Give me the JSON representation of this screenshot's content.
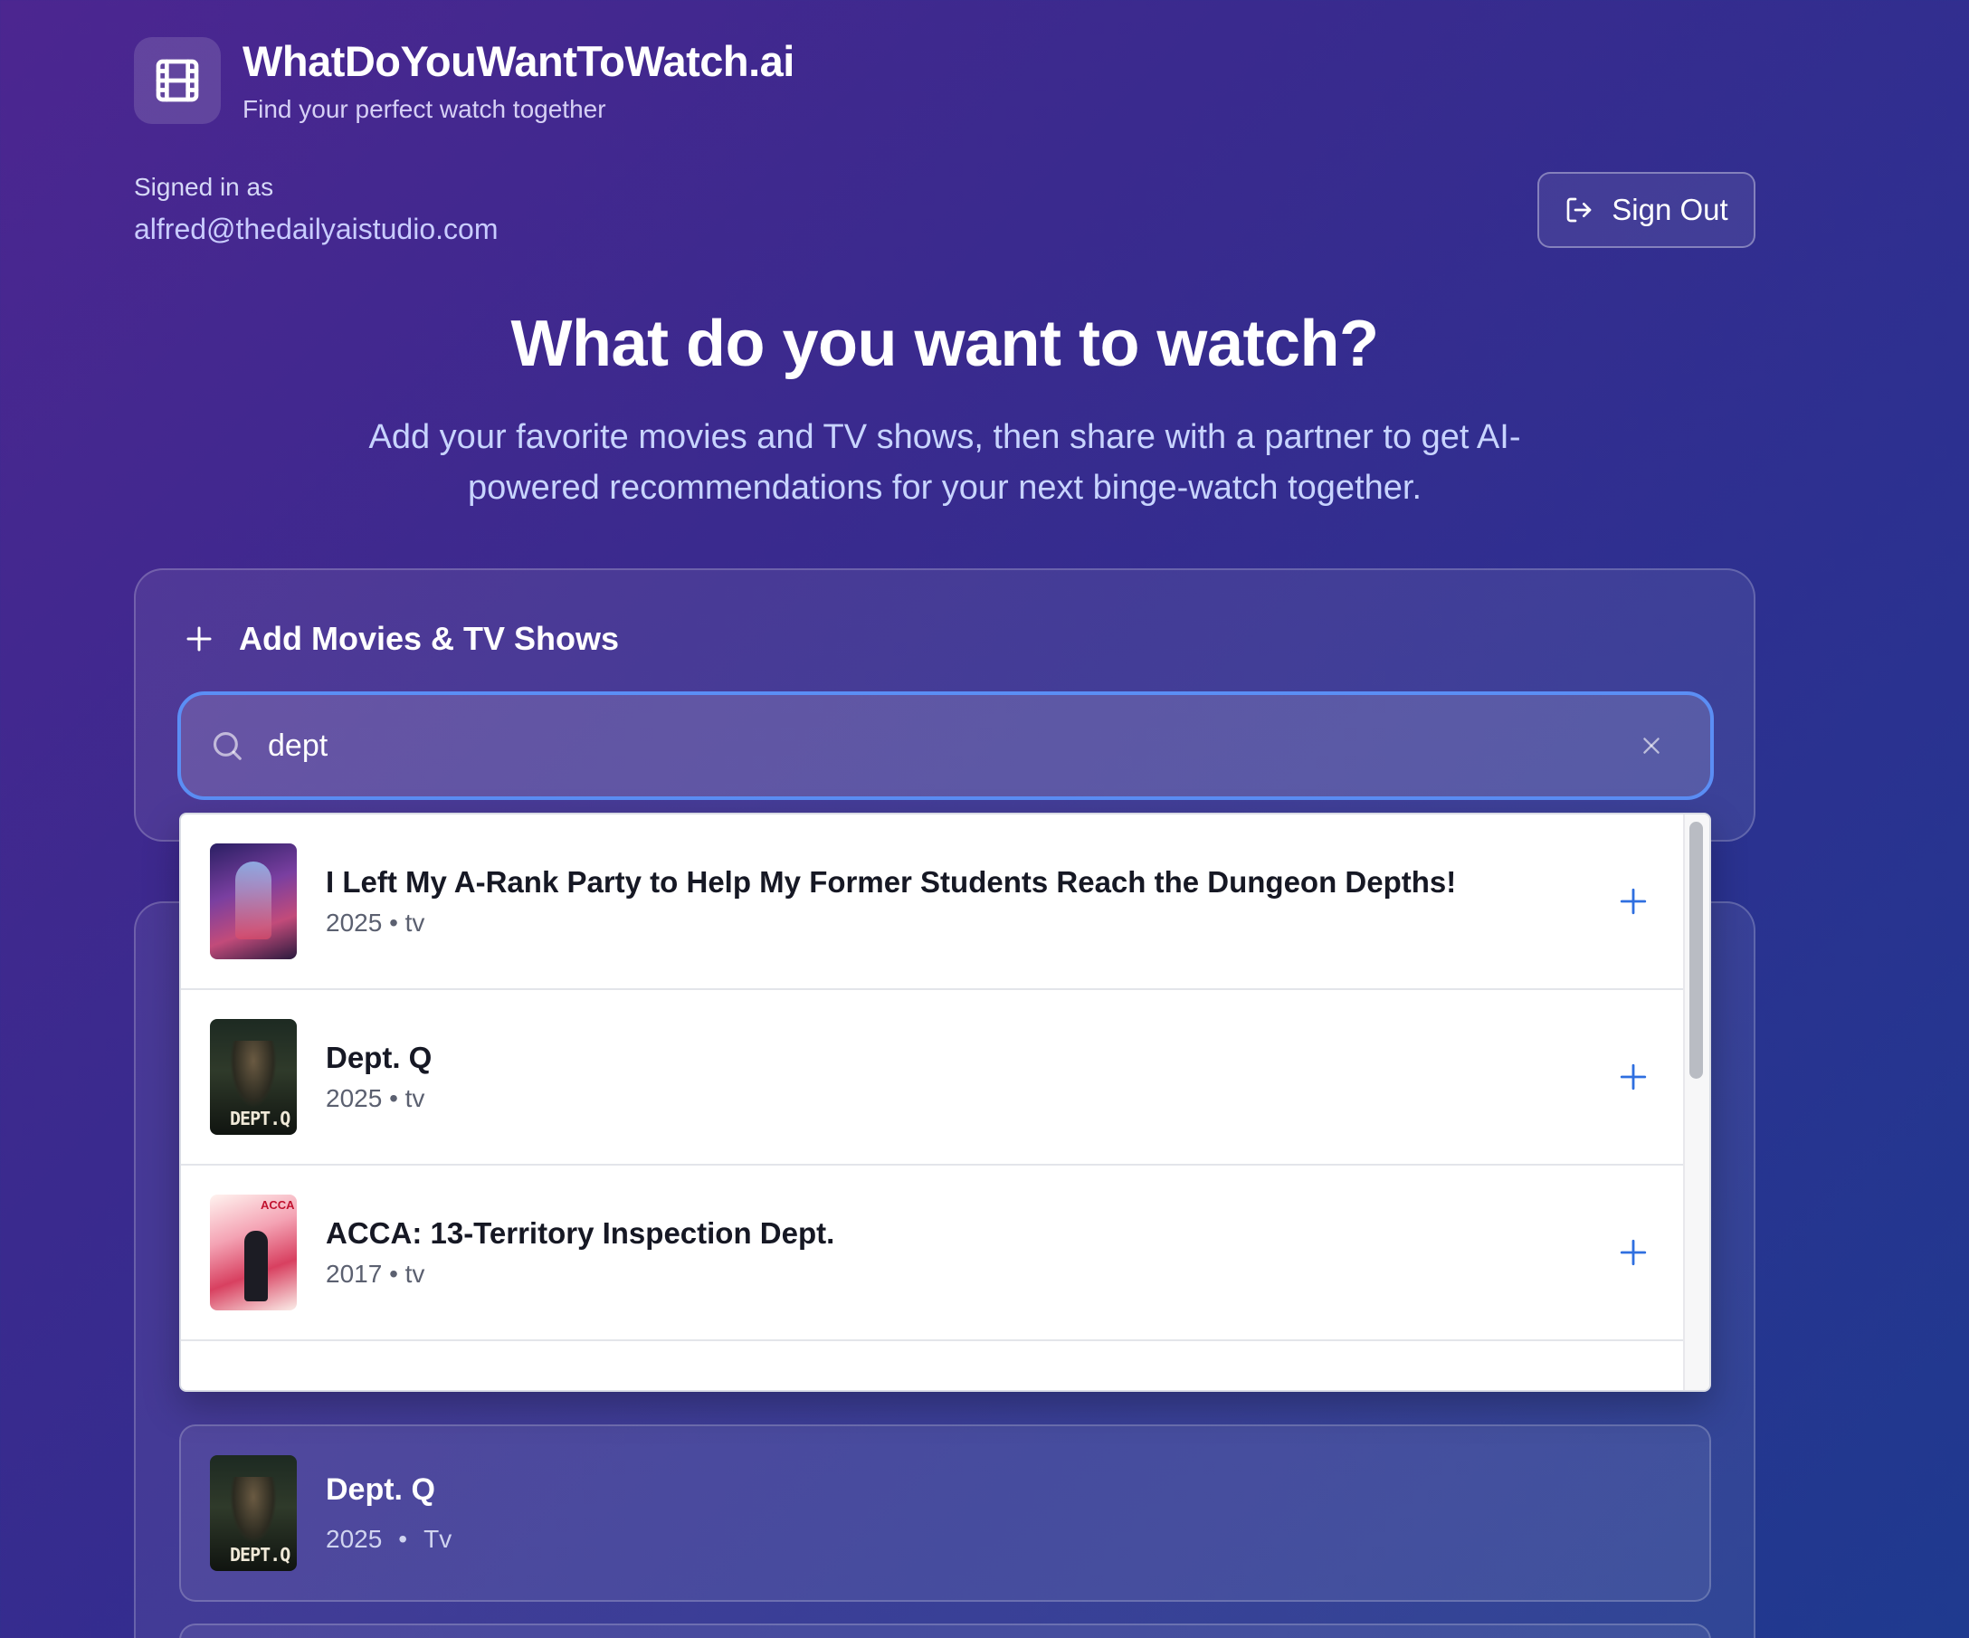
{
  "brand": {
    "title": "WhatDoYouWantToWatch.ai",
    "subtitle": "Find your perfect watch together",
    "icon": "film-icon"
  },
  "session": {
    "label": "Signed in as",
    "email": "alfred@thedailyaistudio.com",
    "sign_out_label": "Sign Out",
    "sign_out_icon": "sign-out-icon"
  },
  "hero": {
    "title": "What do you want to watch?",
    "subtitle": "Add your favorite movies and TV shows, then share with a partner to get AI-powered recommendations for your next binge-watch together."
  },
  "add_panel": {
    "heading": "Add Movies & TV Shows",
    "search": {
      "value": "dept",
      "placeholder": ""
    }
  },
  "search_results": [
    {
      "title": "I Left My A-Rank Party to Help My Former Students Reach the Dungeon Depths!",
      "meta": "2025 • tv",
      "poster_label": ""
    },
    {
      "title": "Dept. Q",
      "meta": "2025 • tv",
      "poster_label": "DEPT.Q"
    },
    {
      "title": "ACCA: 13-Territory Inspection Dept.",
      "meta": "2017 • tv",
      "poster_label": "ACCA"
    }
  ],
  "saved_list": [
    {
      "title": "Dept. Q",
      "year": "2025",
      "type": "Tv",
      "poster_label": "DEPT.Q"
    }
  ],
  "colors": {
    "accent": "#5b8ef5",
    "add_icon": "#2f6fe0"
  }
}
